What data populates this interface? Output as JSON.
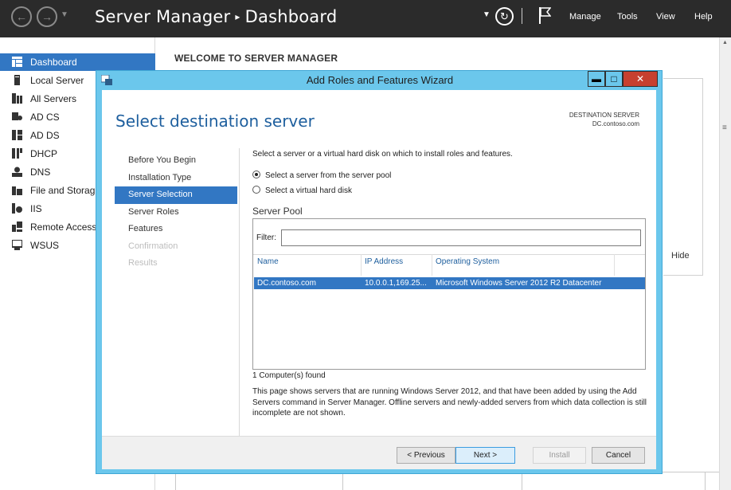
{
  "titlebar": {
    "title": "Server Manager",
    "separator": "▸",
    "page": "Dashboard",
    "menu": [
      "Manage",
      "Tools",
      "View",
      "Help"
    ]
  },
  "sidebar": {
    "items": [
      {
        "label": "Dashboard",
        "icon": "dashboard-icon",
        "active": true
      },
      {
        "label": "Local Server",
        "icon": "local-server-icon"
      },
      {
        "label": "All Servers",
        "icon": "all-servers-icon"
      },
      {
        "label": "AD CS",
        "icon": "ad-cs-icon"
      },
      {
        "label": "AD DS",
        "icon": "ad-ds-icon"
      },
      {
        "label": "DHCP",
        "icon": "dhcp-icon"
      },
      {
        "label": "DNS",
        "icon": "dns-icon"
      },
      {
        "label": "File and Storag",
        "icon": "file-storage-icon"
      },
      {
        "label": "IIS",
        "icon": "iis-icon"
      },
      {
        "label": "Remote Access",
        "icon": "remote-access-icon"
      },
      {
        "label": "WSUS",
        "icon": "wsus-icon"
      }
    ]
  },
  "main": {
    "welcome": "WELCOME TO SERVER MANAGER",
    "hide": "Hide"
  },
  "wizard": {
    "title": "Add Roles and Features Wizard",
    "heading": "Select destination server",
    "destination_label": "DESTINATION SERVER",
    "destination_value": "DC.contoso.com",
    "steps": [
      {
        "label": "Before You Begin",
        "state": "normal"
      },
      {
        "label": "Installation Type",
        "state": "normal"
      },
      {
        "label": "Server Selection",
        "state": "active"
      },
      {
        "label": "Server Roles",
        "state": "normal"
      },
      {
        "label": "Features",
        "state": "normal"
      },
      {
        "label": "Confirmation",
        "state": "disabled"
      },
      {
        "label": "Results",
        "state": "disabled"
      }
    ],
    "description": "Select a server or a virtual hard disk on which to install roles and features.",
    "options": {
      "server_pool": "Select a server from the server pool",
      "vhd": "Select a virtual hard disk"
    },
    "pool_title": "Server Pool",
    "filter_label": "Filter:",
    "filter_value": "",
    "columns": {
      "name": "Name",
      "ip": "IP Address",
      "os": "Operating System"
    },
    "rows": [
      {
        "name": "DC.contoso.com",
        "ip": "10.0.0.1,169.25...",
        "os": "Microsoft Windows Server 2012 R2 Datacenter"
      }
    ],
    "found": "1 Computer(s) found",
    "help": "This page shows servers that are running Windows Server 2012, and that have been added by using the Add Servers command in Server Manager. Offline servers and newly-added servers from which data collection is still incomplete are not shown.",
    "buttons": {
      "previous": "< Previous",
      "next": "Next >",
      "install": "Install",
      "cancel": "Cancel"
    }
  },
  "colors": {
    "titlebar_bg": "#2b2b2b",
    "accent": "#3277c3",
    "wizard_frame": "#6bc7ec",
    "close_button": "#c7402f",
    "heading": "#1e5f9e"
  }
}
